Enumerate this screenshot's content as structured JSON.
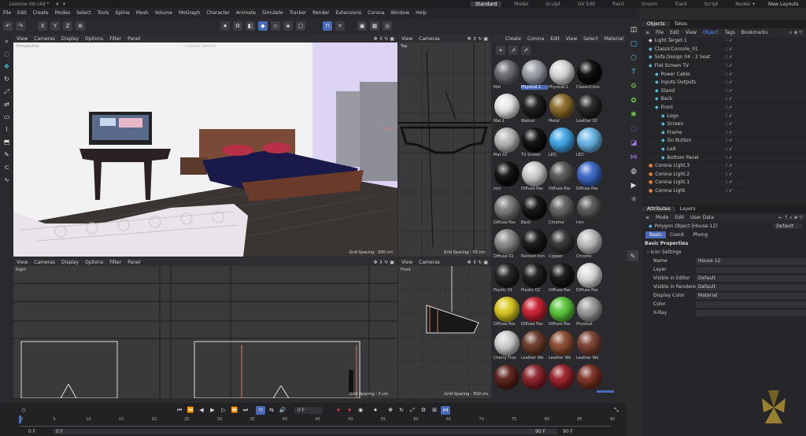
{
  "title_tabs": {
    "file": "Lezione 09.c4d *",
    "layouts": [
      "Standard",
      "Model",
      "Sculpt",
      "UV Edit",
      "Paint",
      "Groom",
      "Track",
      "Script",
      "Nodes"
    ],
    "new_layouts": "New Layouts"
  },
  "main_menu": [
    "File",
    "Edit",
    "Create",
    "Modes",
    "Select",
    "Tools",
    "Spline",
    "Mesh",
    "Volume",
    "MoGraph",
    "Character",
    "Animate",
    "Simulate",
    "Tracker",
    "Render",
    "Extensions",
    "Corona",
    "Window",
    "Help"
  ],
  "axis_toggles": [
    "X",
    "Y",
    "Z"
  ],
  "viewport_menu": [
    "View",
    "Cameras",
    "Display",
    "Options",
    "Filter",
    "Panel"
  ],
  "viewports": {
    "perspective": {
      "label": "Perspective",
      "camera": "Camera Default",
      "grid": "Grid Spacing : 500 cm"
    },
    "top": {
      "label": "Top",
      "grid": "Grid Spacing : 50 cm",
      "menu": [
        "View",
        "Cameras"
      ]
    },
    "right": {
      "label": "Right",
      "grid": "Grid Spacing : 5 cm"
    },
    "front": {
      "label": "Front",
      "grid": "Grid Spacing : 500 cm",
      "menu": [
        "View",
        "Cameras"
      ]
    }
  },
  "material_menu": [
    "Create",
    "Corona",
    "Edit",
    "View",
    "Select",
    "Material"
  ],
  "materials": [
    {
      "name": "Mat",
      "color": "#6a6a70"
    },
    {
      "name": "Physical.2",
      "color": "#9aa0a8",
      "selected": true
    },
    {
      "name": "Physical.1",
      "color": "#d8d8d8"
    },
    {
      "name": "ClassicCons",
      "color": "#0a0a0a"
    },
    {
      "name": "Mat.1",
      "color": "#e8e8e8"
    },
    {
      "name": "Walnut",
      "color": "#1a1a1a"
    },
    {
      "name": "Metal",
      "color": "#8a6a28"
    },
    {
      "name": "Leather 02",
      "color": "#222"
    },
    {
      "name": "Mat 02",
      "color": "#b8b8b8"
    },
    {
      "name": "TV Screen",
      "color": "#0e0e0e"
    },
    {
      "name": "LED",
      "color": "#3fa7e8"
    },
    {
      "name": "LED",
      "color": "#6ab8e8"
    },
    {
      "name": "Iron",
      "color": "#0e0e0e"
    },
    {
      "name": "Diffuse Pas",
      "color": "#cfcfcf"
    },
    {
      "name": "Diffuse Pas",
      "color": "#555"
    },
    {
      "name": "Diffuse Pas",
      "color": "#3a68c8"
    },
    {
      "name": "Diffuse Pas",
      "color": "#7a7a7a"
    },
    {
      "name": "Back",
      "color": "#111"
    },
    {
      "name": "Chrome",
      "color": "#606060"
    },
    {
      "name": "Iron",
      "color": "#555"
    },
    {
      "name": "Diffuse 02",
      "color": "#8a8a8a"
    },
    {
      "name": "Painted Iron",
      "color": "#151515"
    },
    {
      "name": "Copper",
      "color": "#333"
    },
    {
      "name": "Chrome",
      "color": "#bdbdbd"
    },
    {
      "name": "Plastic 01",
      "color": "#1e1e1e"
    },
    {
      "name": "Plastic 02",
      "color": "#1a1a1a"
    },
    {
      "name": "Diffuse Pas",
      "color": "#141414"
    },
    {
      "name": "Diffuse Pas",
      "color": "#dcdcdc"
    },
    {
      "name": "Diffuse Pas",
      "color": "#d8c820"
    },
    {
      "name": "Diffuse Pas",
      "color": "#c82030"
    },
    {
      "name": "Diffuse Pas",
      "color": "#58c838"
    },
    {
      "name": "Physical",
      "color": "#9a9a9a"
    },
    {
      "name": "Cherry Floo",
      "color": "#cfcfcf"
    },
    {
      "name": "Leather Wo",
      "color": "#6a3a28"
    },
    {
      "name": "Leather Wo",
      "color": "#8a4a30"
    },
    {
      "name": "Leather Wo",
      "color": "#7a4030"
    },
    {
      "name": "",
      "color": "#5a2018"
    },
    {
      "name": "",
      "color": "#8a2028"
    },
    {
      "name": "",
      "color": "#9a2028"
    },
    {
      "name": "",
      "color": "#7a3020"
    }
  ],
  "objects_panel": {
    "tabs": [
      "Objects",
      "Takes"
    ],
    "menu": [
      "File",
      "Edit",
      "View",
      "Object",
      "Tags",
      "Bookmarks"
    ],
    "rows": [
      {
        "name": "Light.Target.1",
        "indent": 0
      },
      {
        "name": "ClassicConsole_01",
        "indent": 0
      },
      {
        "name": "Sofa Design 04 - 2 Seat",
        "indent": 0
      },
      {
        "name": "Flat Screen TV",
        "indent": 0
      },
      {
        "name": "Power Cable",
        "indent": 1
      },
      {
        "name": "Inputs Outputs",
        "indent": 1
      },
      {
        "name": "Stand",
        "indent": 1
      },
      {
        "name": "Back",
        "indent": 1
      },
      {
        "name": "Front",
        "indent": 1
      },
      {
        "name": "Logo",
        "indent": 2
      },
      {
        "name": "Screen",
        "indent": 2
      },
      {
        "name": "Frame",
        "indent": 2
      },
      {
        "name": "On Button",
        "indent": 2
      },
      {
        "name": "Led",
        "indent": 2
      },
      {
        "name": "Bottom Panel",
        "indent": 2
      },
      {
        "name": "Corona Light.3",
        "indent": 0
      },
      {
        "name": "Corona Light.2",
        "indent": 0
      },
      {
        "name": "Corona Light.1",
        "indent": 0
      },
      {
        "name": "Corona Light",
        "indent": 0
      }
    ]
  },
  "attributes_panel": {
    "tabs": [
      "Attributes",
      "Layers"
    ],
    "menu": [
      "Mode",
      "Edit",
      "User Data"
    ],
    "object_title": "Polygon Object [House 12]",
    "preset": "Default",
    "subtabs": [
      "Basic",
      "Coord.",
      "Phong"
    ],
    "section": "Basic Properties",
    "subsection": "Icon Settings",
    "fields": [
      {
        "label": "Name",
        "value": "House 12"
      },
      {
        "label": "Layer",
        "value": ""
      },
      {
        "label": "Visible in Editor",
        "value": "Default"
      },
      {
        "label": "Visible in Renderer",
        "value": "Default"
      },
      {
        "label": "Display Color",
        "value": "Material"
      },
      {
        "label": "Color",
        "value": ""
      },
      {
        "label": "X-Ray",
        "value": ""
      }
    ]
  },
  "timeline": {
    "current_frame": "0 F",
    "start": "0 F",
    "start2": "0 F",
    "end": "90 F",
    "end2": "90 F",
    "ticks": [
      "0",
      "5",
      "10",
      "15",
      "20",
      "25",
      "30",
      "35",
      "40",
      "45",
      "50",
      "55",
      "60",
      "65",
      "70",
      "75",
      "80",
      "85",
      "90"
    ]
  }
}
